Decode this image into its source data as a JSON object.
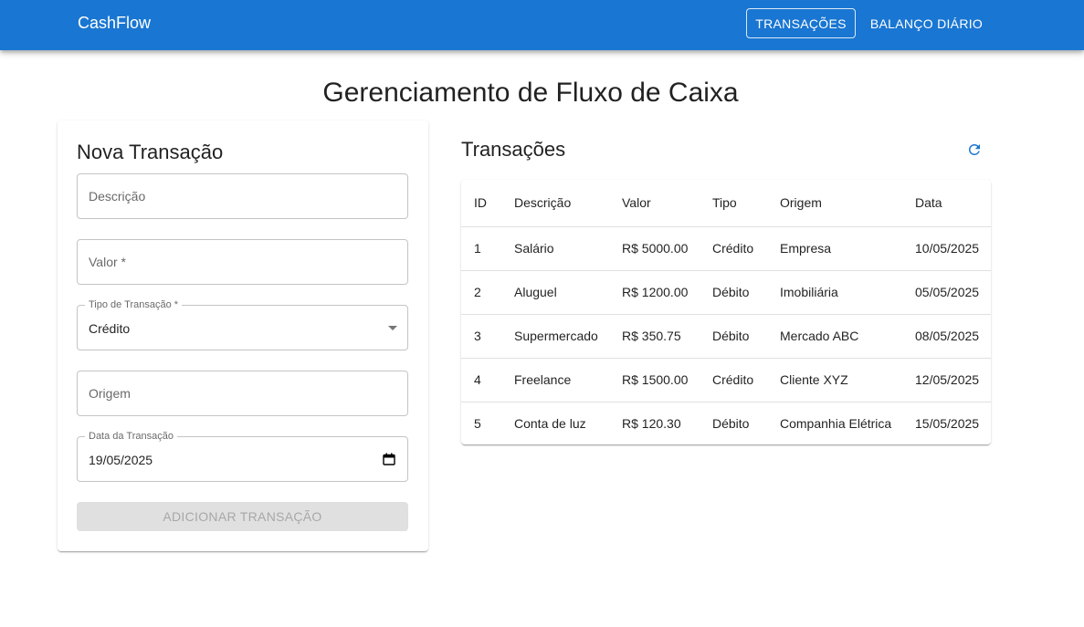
{
  "header": {
    "brand": "CashFlow",
    "nav": [
      {
        "label": "Transações",
        "active": true
      },
      {
        "label": "Balanço Diário",
        "active": false
      }
    ]
  },
  "page": {
    "title": "Gerenciamento de Fluxo de Caixa"
  },
  "form": {
    "title": "Nova Transação",
    "fields": {
      "descricao": {
        "placeholder": "Descrição"
      },
      "valor": {
        "placeholder": "Valor *"
      },
      "tipo": {
        "label": "Tipo de Transação *",
        "value": "Crédito"
      },
      "origem": {
        "placeholder": "Origem"
      },
      "data": {
        "label": "Data da Transação",
        "value": "19/05/2025"
      }
    },
    "submit_label": "Adicionar Transação"
  },
  "transactions": {
    "title": "Transações",
    "refresh_icon": "refresh-icon",
    "columns": [
      "ID",
      "Descrição",
      "Valor",
      "Tipo",
      "Origem",
      "Data"
    ],
    "rows": [
      [
        "1",
        "Salário",
        "R$ 5000.00",
        "Crédito",
        "Empresa",
        "10/05/2025"
      ],
      [
        "2",
        "Aluguel",
        "R$ 1200.00",
        "Débito",
        "Imobiliária",
        "05/05/2025"
      ],
      [
        "3",
        "Supermercado",
        "R$ 350.75",
        "Débito",
        "Mercado ABC",
        "08/05/2025"
      ],
      [
        "4",
        "Freelance",
        "R$ 1500.00",
        "Crédito",
        "Cliente XYZ",
        "12/05/2025"
      ],
      [
        "5",
        "Conta de luz",
        "R$ 120.30",
        "Débito",
        "Companhia Elétrica",
        "15/05/2025"
      ]
    ]
  },
  "colors": {
    "primary": "#1976d2",
    "disabled_bg": "#e0e0e0"
  }
}
